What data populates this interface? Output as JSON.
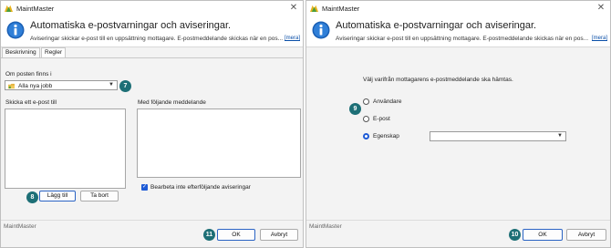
{
  "left_window": {
    "title": "MaintMaster",
    "header_title": "Automatiska e-postvarningar och aviseringar.",
    "header_subtitle": "Aviseringar skickar e-post till en uppsättning mottagare. E-postmeddelande skickas när en pos...",
    "more_link": "[mera]",
    "tabs": [
      "Beskrivning",
      "Regler"
    ],
    "active_tab": "Regler",
    "if_post_label": "Om posten finns i",
    "dropdown_value": "Alla nya jobb",
    "send_to_label": "Skicka ett e-post till",
    "message_label": "Med följande meddelande",
    "process_checkbox_label": "Bearbeta inte efterföljande aviseringar",
    "process_checked": true,
    "add_button": "Lägg till",
    "remove_button": "Ta bort",
    "footer_label": "MaintMaster",
    "ok_button": "OK",
    "cancel_button": "Avbryt",
    "badges": {
      "dropdown": "7",
      "add": "8",
      "ok": "11"
    }
  },
  "right_window": {
    "title": "MaintMaster",
    "header_title": "Automatiska e-postvarningar och aviseringar.",
    "header_subtitle": "Aviseringar skickar e-post till en uppsättning mottagare. E-postmeddelande skickas när en pos...",
    "more_link": "[mera]",
    "prompt": "Välj varifrån mottagarens e-postmeddelande ska hämtas.",
    "options": [
      "Användare",
      "E-post",
      "Egenskap"
    ],
    "selected_option": "Egenskap",
    "property_value": "",
    "footer_label": "MaintMaster",
    "ok_button": "OK",
    "cancel_button": "Avbryt",
    "badges": {
      "options": "9",
      "ok": "10"
    }
  },
  "colors": {
    "accent": "#1e5bd6",
    "badge": "#1d6f76",
    "link": "#0a4fa8"
  }
}
